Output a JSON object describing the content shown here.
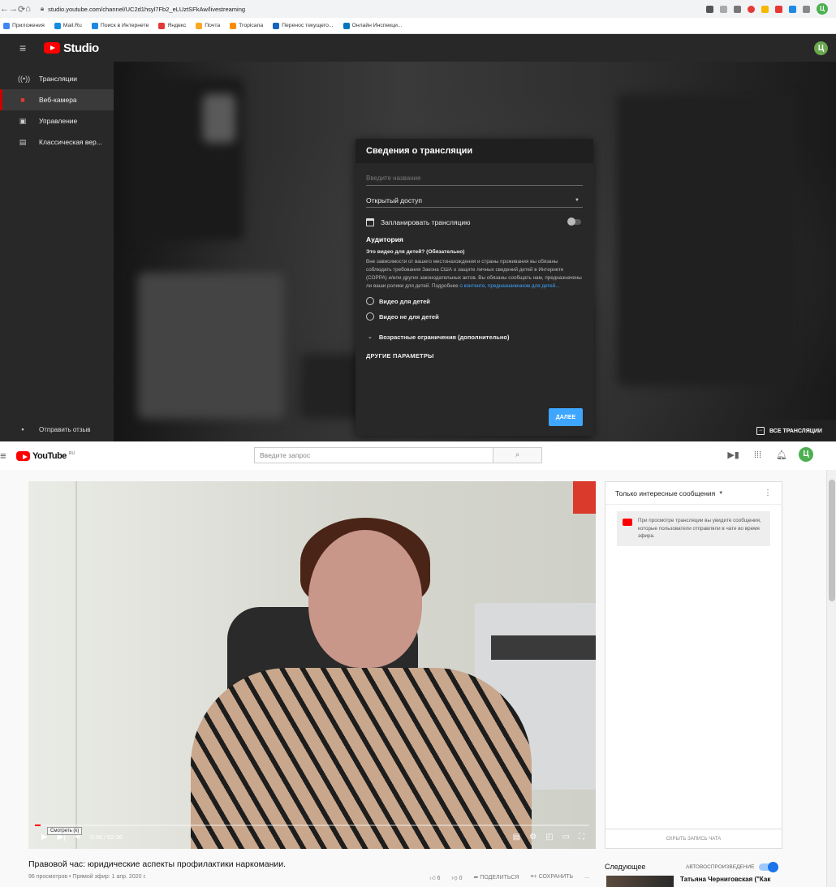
{
  "browser": {
    "url": "studio.youtube.com/channel/UC2d1hsyl7Fb2_eLUztSFkAw/livestreaming",
    "profile_initial": "Ц",
    "bookmarks": [
      "Приложения",
      "Mail.Ru",
      "Поиск в Интернете",
      "Яндекс",
      "Почта",
      "Tropicana",
      "Перенос текущего...",
      "Онлайн Инспекци..."
    ]
  },
  "studio": {
    "logo_text": "Studio",
    "avatar_initial": "Ц",
    "sidebar": {
      "items": [
        {
          "label": "Трансляции",
          "icon": "broadcast-icon"
        },
        {
          "label": "Веб-камера",
          "icon": "camera-icon"
        },
        {
          "label": "Управление",
          "icon": "calendar-icon"
        },
        {
          "label": "Классическая вер...",
          "icon": "classic-icon"
        }
      ],
      "feedback_label": "Отправить отзыв"
    },
    "dialog": {
      "title": "Сведения о трансляции",
      "name_placeholder": "Введите название",
      "privacy_value": "Открытый доступ",
      "schedule_label": "Запланировать трансляцию",
      "audience_heading": "Аудитория",
      "audience_question": "Это видео для детей? (Обязательно)",
      "audience_text": "Вне зависимости от вашего местонахождения и страны проживания вы обязаны соблюдать требования Закона США о защите личных сведений детей в Интернете (COPPA) и/или других законодательных актов. Вы обязаны сообщать нам, предназначены ли ваши ролики для детей. Подробнее",
      "audience_link": "о контенте, предназначенном для детей...",
      "option_kids": "Видео для детей",
      "option_not_kids": "Видео не для детей",
      "age_restrictions": "Возрастные ограничения (дополнительно)",
      "other_params": "ДРУГИЕ ПАРАМЕТРЫ",
      "next_button": "ДАЛЕЕ"
    },
    "all_streams_button": "ВСЕ ТРАНСЛЯЦИИ"
  },
  "youtube": {
    "logo_text": "YouTube",
    "logo_region": "RU",
    "search_placeholder": "Введите запрос",
    "avatar_initial": "Ц",
    "player": {
      "time": "0:06 / 52:36",
      "progress_fraction": 0.002,
      "tooltip": "Смотреть (k)"
    },
    "video_title": "Правовой час: юридические аспекты профилактики наркомании.",
    "video_meta": "96 просмотров • Прямой эфир: 1 апр. 2020 г.",
    "actions": {
      "likes": "6",
      "dislikes": "0",
      "share": "ПОДЕЛИТЬСЯ",
      "save": "СОХРАНИТЬ",
      "more": "..."
    },
    "chat": {
      "header": "Только интересные сообщения",
      "note": "При просмотре трансляции вы увидите сообщения, которые пользователи отправляли в чате во время эфира.",
      "hide_label": "СКРЫТЬ ЗАПИСЬ ЧАТА"
    },
    "up_next": {
      "label": "Следующее",
      "autoplay_label": "АВТОВОСПРОИЗВЕДЕНИЕ",
      "first_title": "Татьяна Черниговская (\"Как"
    }
  }
}
